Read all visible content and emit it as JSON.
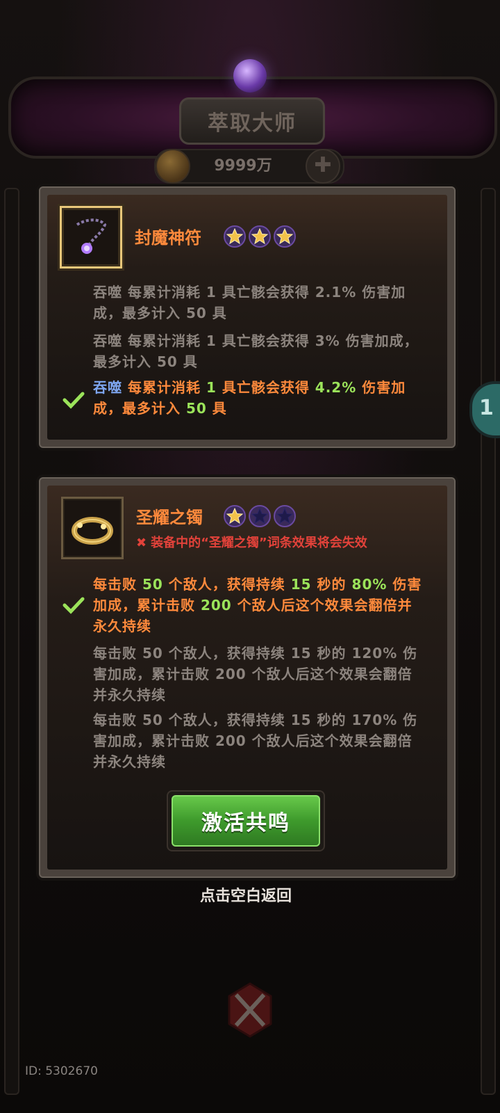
{
  "header": {
    "title": "萃取大师",
    "currency": "9999万"
  },
  "side_tab": {
    "label": "1"
  },
  "item1": {
    "name": "封魔神符",
    "stars": 3,
    "levels": [
      {
        "active": false,
        "segments": [
          {
            "t": "吞噬 每累计消耗 1 具亡骸会获得 2.1% 伤害加成，最多计入 50 具",
            "c": "plain"
          }
        ]
      },
      {
        "active": false,
        "segments": [
          {
            "t": "吞噬 每累计消耗 1 具亡骸会获得 3% 伤害加成，最多计入 50 具",
            "c": "plain"
          }
        ]
      },
      {
        "active": true,
        "segments": [
          {
            "t": "吞噬",
            "c": "kw"
          },
          {
            "t": " 每累计消耗 ",
            "c": "plain"
          },
          {
            "t": "1",
            "c": "num"
          },
          {
            "t": " 具亡骸会获得 ",
            "c": "plain"
          },
          {
            "t": "4.2%",
            "c": "num"
          },
          {
            "t": " 伤害加成，最多计入 ",
            "c": "plain"
          },
          {
            "t": "50",
            "c": "num"
          },
          {
            "t": " 具",
            "c": "plain"
          }
        ]
      }
    ]
  },
  "item2": {
    "name": "圣耀之镯",
    "stars": 1,
    "warning": "装备中的“圣耀之镯”词条效果将会失效",
    "levels": [
      {
        "active": true,
        "segments": [
          {
            "t": "每击败 ",
            "c": "plain"
          },
          {
            "t": "50",
            "c": "num"
          },
          {
            "t": " 个敌人，获得持续 ",
            "c": "plain"
          },
          {
            "t": "15",
            "c": "num"
          },
          {
            "t": " 秒的 ",
            "c": "plain"
          },
          {
            "t": "80%",
            "c": "num"
          },
          {
            "t": " 伤害加成，累计击败 ",
            "c": "plain"
          },
          {
            "t": "200",
            "c": "num"
          },
          {
            "t": " 个敌人后这个效果会翻倍并永久持续",
            "c": "plain"
          }
        ]
      },
      {
        "active": false,
        "segments": [
          {
            "t": "每击败 50 个敌人，获得持续 15 秒的 120% 伤害加成，累计击败 200 个敌人后这个效果会翻倍并永久持续",
            "c": "plain"
          }
        ]
      },
      {
        "active": false,
        "segments": [
          {
            "t": "每击败 50 个敌人，获得持续 15 秒的 170% 伤害加成，累计击败 200 个敌人后这个效果会翻倍并永久持续",
            "c": "plain"
          }
        ]
      }
    ]
  },
  "activate_label": "激活共鸣",
  "back_hint": "点击空白返回",
  "id_text": "ID: 5302670",
  "colors": {
    "accent_orange": "#ff8a3c",
    "value_green": "#9be35a",
    "keyword_blue": "#7ea6f0",
    "warning_red": "#e2423a",
    "button_green": "#3e9a2c"
  },
  "icons": {
    "item1": "amulet-icon",
    "item2": "bracelet-icon",
    "coin": "coin-icon",
    "add": "cross-icon",
    "check": "check-icon"
  }
}
